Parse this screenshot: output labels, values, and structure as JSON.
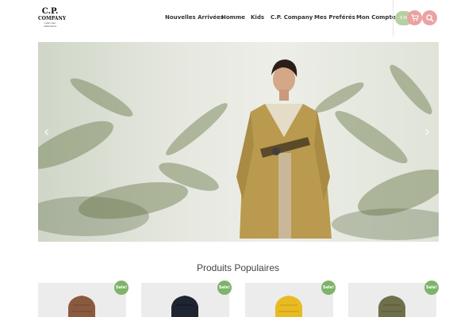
{
  "header": {
    "logo": {
      "line1": "C.P.",
      "line2": "COMPANY",
      "line3": "Labo des vêtements"
    },
    "nav": [
      "Nouvelles Arrivées",
      "Homme",
      "Kids",
      "C.P. Company",
      "Mes Preférés",
      "Mon Compte"
    ],
    "cart_amount": "0.00",
    "cart_icon": "cart-icon",
    "search_icon": "search-icon"
  },
  "hero": {
    "prev_label": "‹",
    "next_label": "›"
  },
  "section": {
    "title": "Produits Populaires"
  },
  "products": [
    {
      "badge": "Sale!",
      "color": "#8a5a3e"
    },
    {
      "badge": "Sale!",
      "color": "#1f2433"
    },
    {
      "badge": "Sale!",
      "color": "#e8bb23"
    },
    {
      "badge": "Sale!",
      "color": "#6f6f4a"
    }
  ],
  "colors": {
    "accent_pink": "#eaa2a3",
    "accent_green": "#b6d0a4",
    "sale_green": "#7db36a"
  }
}
